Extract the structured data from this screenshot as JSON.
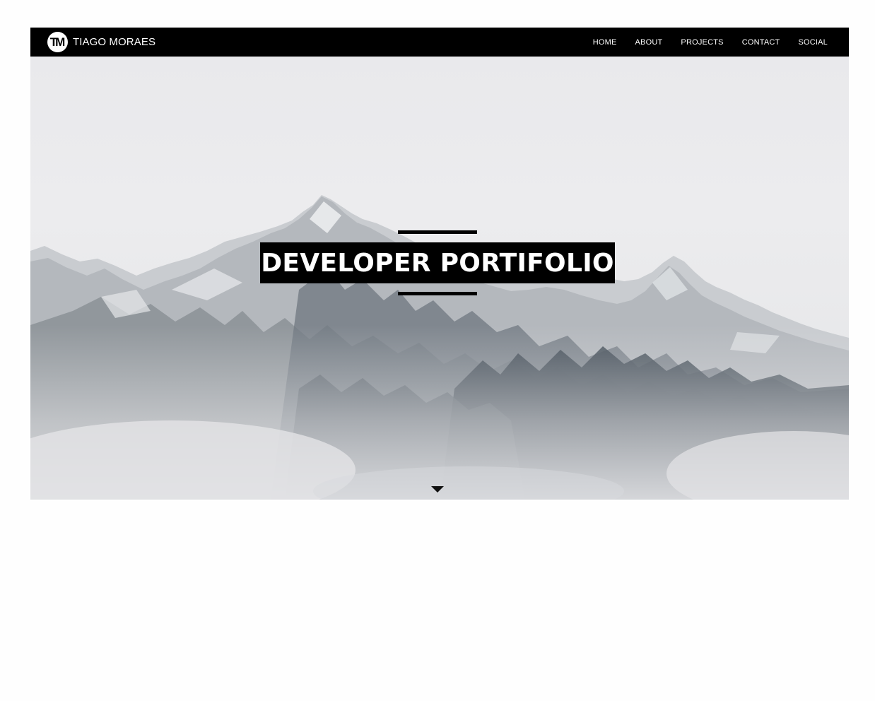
{
  "brand": {
    "logo_text": "TM",
    "name": "TIAGO MORAES"
  },
  "nav": {
    "items": [
      {
        "label": "HOME"
      },
      {
        "label": "ABOUT"
      },
      {
        "label": "PROJECTS"
      },
      {
        "label": "CONTACT"
      },
      {
        "label": "SOCIAL"
      }
    ]
  },
  "hero": {
    "title": "DEVELOPER PORTIFOLIO",
    "scroll_icon": "caret-down-icon",
    "background": "snowy-mountain-photo"
  },
  "colors": {
    "navbar_bg": "#000000",
    "nav_text": "#ffffff",
    "title_bg": "#000000",
    "title_text": "#ffffff",
    "sky": "#ebebed",
    "page_bg": "#fefefe"
  }
}
